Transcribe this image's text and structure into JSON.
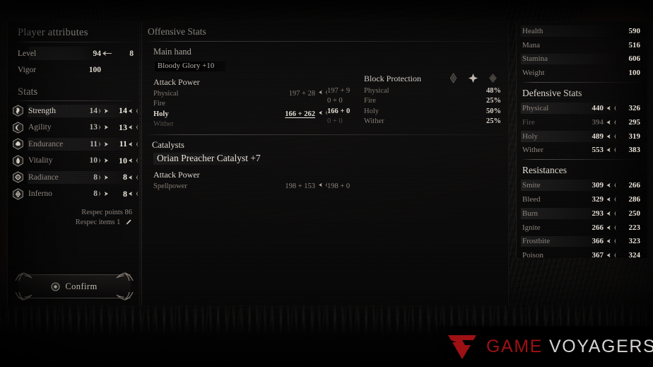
{
  "left_panel": {
    "title": "Player attributes",
    "attributes": [
      {
        "label": "Level",
        "value": "94",
        "second": "8",
        "highlight": true
      },
      {
        "label": "Vigor",
        "value": "100",
        "second": "",
        "highlight": false
      }
    ],
    "stats_title": "Stats",
    "stats": [
      {
        "icon": "strength-icon",
        "name": "Strength",
        "value": "14",
        "value2": "14",
        "highlight": true
      },
      {
        "icon": "agility-icon",
        "name": "Agility",
        "value": "13",
        "value2": "13",
        "highlight": false
      },
      {
        "icon": "endurance-icon",
        "name": "Endurance",
        "value": "11",
        "value2": "11",
        "highlight": true
      },
      {
        "icon": "vitality-icon",
        "name": "Vitality",
        "value": "10",
        "value2": "10",
        "highlight": false
      },
      {
        "icon": "radiance-icon",
        "name": "Radiance",
        "value": "8",
        "value2": "8",
        "highlight": true
      },
      {
        "icon": "inferno-icon",
        "name": "Inferno",
        "value": "8",
        "value2": "8",
        "highlight": false
      }
    ],
    "respec_points_label": "Respec points 86",
    "respec_items_label": "Respec items 1",
    "confirm_label": "Confirm"
  },
  "center_panel": {
    "title": "Offensive Stats",
    "main_hand_label": "Main hand",
    "weapon_name": "Bloody Glory +10",
    "attack_power_label": "Attack Power",
    "attack_power": [
      {
        "name": "Physical",
        "base": "197 + 28",
        "result": "197 + 9",
        "style": "normal"
      },
      {
        "name": "Fire",
        "base": "",
        "result": "0 + 0",
        "style": "normal"
      },
      {
        "name": "Holy",
        "base": "166 + 262",
        "result": "166 + 0",
        "style": "bright"
      },
      {
        "name": "Wither",
        "base": "",
        "result": "0 + 0",
        "style": "dim"
      }
    ],
    "block_protection_label": "Block Protection",
    "block_protection": [
      {
        "name": "Physical",
        "value": "48%",
        "style": "normal"
      },
      {
        "name": "Fire",
        "value": "25%",
        "style": "normal"
      },
      {
        "name": "Holy",
        "value": "50%",
        "style": "normal"
      },
      {
        "name": "Wither",
        "value": "25%",
        "style": "normal"
      }
    ],
    "catalysts_label": "Catalysts",
    "catalyst_name": "Orian Preacher Catalyst +7",
    "catalyst_attack_power_label": "Attack Power",
    "catalyst_stats": [
      {
        "name": "Spellpower",
        "base": "198 + 153",
        "result": "198 + 0",
        "style": "normal"
      }
    ],
    "slot_icons": [
      "slot-diamond-icon",
      "slot-diamond-icon",
      "slot-diamond-icon"
    ]
  },
  "right_panel": {
    "vitals": [
      {
        "name": "Health",
        "value": "590",
        "highlight": true
      },
      {
        "name": "Mana",
        "value": "516",
        "highlight": false
      },
      {
        "name": "Stamina",
        "value": "606",
        "highlight": true
      },
      {
        "name": "Weight",
        "value": "100",
        "highlight": false
      }
    ],
    "defensive_title": "Defensive Stats",
    "defensive": [
      {
        "name": "Physical",
        "value": "440",
        "value2": "326",
        "highlight": true,
        "dim": false
      },
      {
        "name": "Fire",
        "value": "394",
        "value2": "295",
        "highlight": false,
        "dim": true
      },
      {
        "name": "Holy",
        "value": "489",
        "value2": "319",
        "highlight": true,
        "dim": false
      },
      {
        "name": "Wither",
        "value": "553",
        "value2": "383",
        "highlight": false,
        "dim": false
      }
    ],
    "resistances_title": "Resistances",
    "resistances": [
      {
        "name": "Smite",
        "value": "309",
        "value2": "266",
        "highlight": true
      },
      {
        "name": "Bleed",
        "value": "329",
        "value2": "286",
        "highlight": false
      },
      {
        "name": "Burn",
        "value": "293",
        "value2": "250",
        "highlight": true
      },
      {
        "name": "Ignite",
        "value": "266",
        "value2": "223",
        "highlight": false
      },
      {
        "name": "Frostbite",
        "value": "366",
        "value2": "323",
        "highlight": true
      },
      {
        "name": "Poison",
        "value": "367",
        "value2": "324",
        "highlight": false
      }
    ]
  },
  "watermark": {
    "mark": "chevron-logo-icon",
    "text_primary": "GAME",
    "text_secondary": "VOYAGERS",
    "primary_color": "#9d1115",
    "secondary_color": "#d6d4d3"
  }
}
